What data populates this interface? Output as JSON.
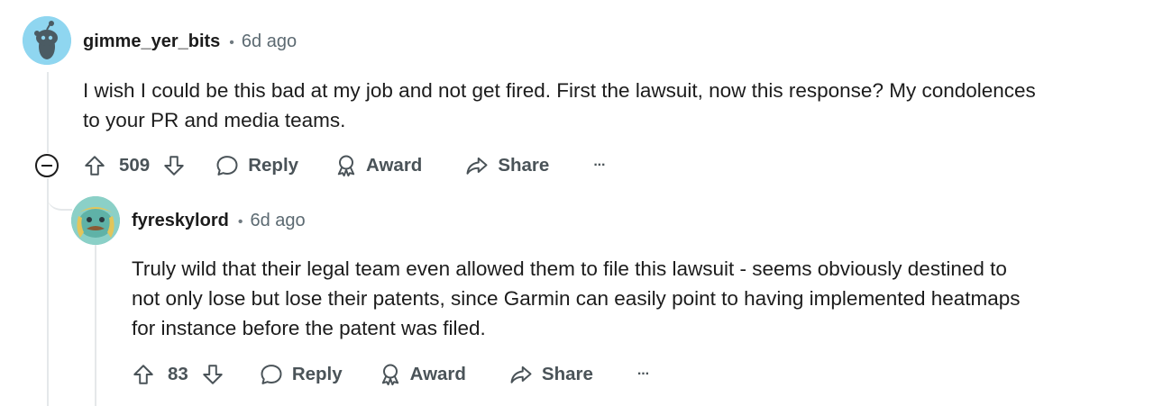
{
  "comments": [
    {
      "username": "gimme_yer_bits",
      "separator": "•",
      "time": "6d ago",
      "body_lines": [
        "I wish I could be this bad at my job and not get fired. First the lawsuit, now this response? My condolences",
        "to your PR and media teams."
      ],
      "votes": "509",
      "reply_label": "Reply",
      "award_label": "Award",
      "share_label": "Share",
      "more_label": "···",
      "avatar_color": "#8fd6f0"
    },
    {
      "username": "fyreskylord",
      "separator": "•",
      "time": "6d ago",
      "body_lines": [
        "Truly wild that their legal team even allowed them to file this lawsuit - seems obviously destined to",
        "not only lose but lose their patents, since Garmin can easily point to having implemented heatmaps",
        "for instance before the patent was filed."
      ],
      "votes": "83",
      "reply_label": "Reply",
      "award_label": "Award",
      "share_label": "Share",
      "more_label": "···",
      "avatar_color": "#6fc2b8"
    }
  ],
  "colors": {
    "thread_line": "#e5e8ea",
    "action_text": "#4a5358",
    "meta_text": "#5c6a72"
  }
}
